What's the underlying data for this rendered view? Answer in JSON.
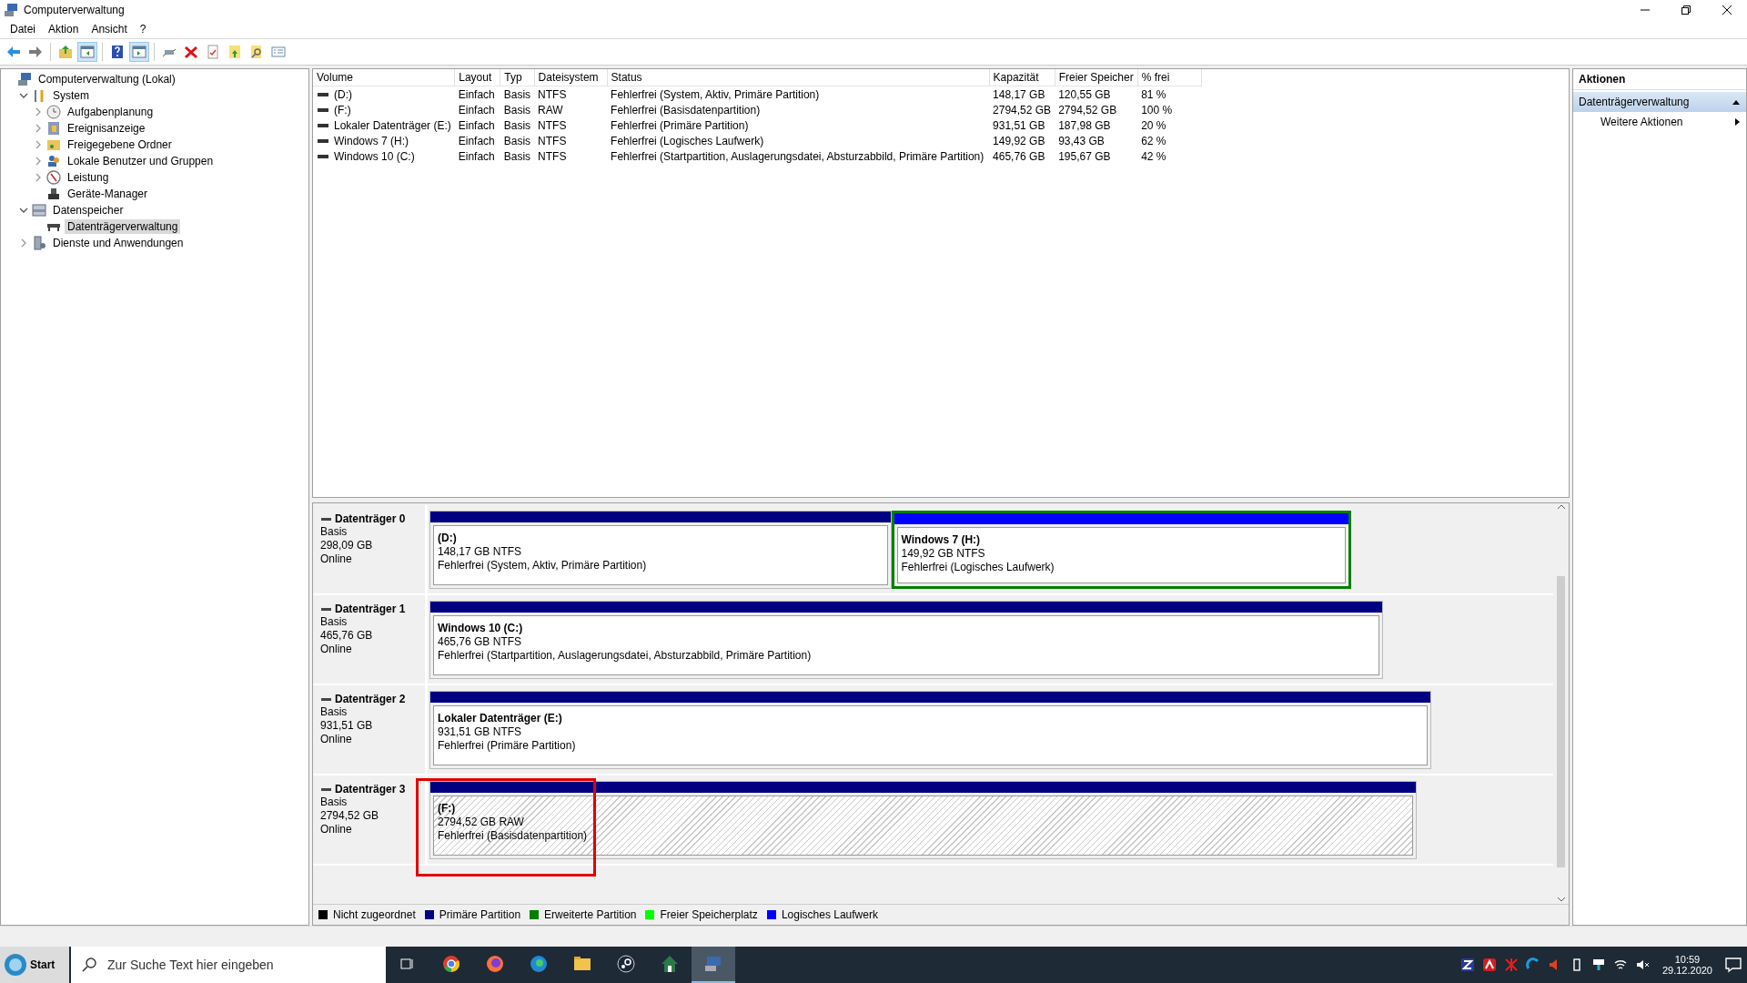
{
  "window": {
    "title": "Computerverwaltung"
  },
  "menu": [
    "Datei",
    "Aktion",
    "Ansicht",
    "?"
  ],
  "toolbar": [
    {
      "kind": "back",
      "pressed": false
    },
    {
      "kind": "forward",
      "pressed": false
    },
    {
      "kind": "sep"
    },
    {
      "kind": "up",
      "pressed": false
    },
    {
      "kind": "pane",
      "pressed": true
    },
    {
      "kind": "sep"
    },
    {
      "kind": "help",
      "pressed": false
    },
    {
      "kind": "pane2",
      "pressed": true
    },
    {
      "kind": "sep"
    },
    {
      "kind": "connect",
      "pressed": false
    },
    {
      "kind": "delete",
      "pressed": false
    },
    {
      "kind": "properties",
      "pressed": false
    },
    {
      "kind": "export",
      "pressed": false
    },
    {
      "kind": "find",
      "pressed": false
    },
    {
      "kind": "list",
      "pressed": false
    }
  ],
  "tree": [
    {
      "label": "Computerverwaltung (Lokal)",
      "selected": false,
      "children": [
        {
          "label": "System",
          "selected": false,
          "expanded": true,
          "children": [
            {
              "label": "Aufgabenplanung",
              "selected": false,
              "expanded": false
            },
            {
              "label": "Ereignisanzeige",
              "selected": false,
              "expanded": false
            },
            {
              "label": "Freigegebene Ordner",
              "selected": false,
              "expanded": false
            },
            {
              "label": "Lokale Benutzer und Gruppen",
              "selected": false,
              "expanded": false
            },
            {
              "label": "Leistung",
              "selected": false,
              "expanded": false
            },
            {
              "label": "Geräte-Manager",
              "selected": false
            }
          ]
        },
        {
          "label": "Datenspeicher",
          "selected": false,
          "expanded": true,
          "children": [
            {
              "label": "Datenträgerverwaltung",
              "selected": true
            }
          ]
        },
        {
          "label": "Dienste und Anwendungen",
          "selected": false,
          "expanded": false
        }
      ]
    }
  ],
  "volumes": {
    "columns": [
      "Volume",
      "Layout",
      "Typ",
      "Dateisystem",
      "Status",
      "Kapazität",
      "Freier Speicher",
      "% frei"
    ],
    "rows": [
      [
        "(D:)",
        "Einfach",
        "Basis",
        "NTFS",
        "Fehlerfrei (System, Aktiv, Primäre Partition)",
        "148,17 GB",
        "120,55 GB",
        "81 %"
      ],
      [
        "(F:)",
        "Einfach",
        "Basis",
        "RAW",
        "Fehlerfrei (Basisdatenpartition)",
        "2794,52 GB",
        "2794,52 GB",
        "100 %"
      ],
      [
        "Lokaler Datenträger (E:)",
        "Einfach",
        "Basis",
        "NTFS",
        "Fehlerfrei (Primäre Partition)",
        "931,51 GB",
        "187,98 GB",
        "20 %"
      ],
      [
        "Windows 7 (H:)",
        "Einfach",
        "Basis",
        "NTFS",
        "Fehlerfrei (Logisches Laufwerk)",
        "149,92 GB",
        "93,43 GB",
        "62 %"
      ],
      [
        "Windows 10 (C:)",
        "Einfach",
        "Basis",
        "NTFS",
        "Fehlerfrei (Startpartition, Auslagerungsdatei, Absturzabbild, Primäre Partition)",
        "465,76 GB",
        "195,67 GB",
        "42 %"
      ]
    ]
  },
  "disks": [
    {
      "name": "Datenträger 0",
      "type": "Basis",
      "size": "298,09 GB",
      "state": "Online",
      "partitions": [
        {
          "kind": "primary",
          "selected": false,
          "name": "(D:)",
          "size": "148,17 GB NTFS",
          "status": "Fehlerfrei (System, Aktiv, Primäre Partition)"
        },
        {
          "kind": "logical",
          "selected": false,
          "name": "Windows 7  (H:)",
          "size": "149,92 GB NTFS",
          "status": "Fehlerfrei (Logisches Laufwerk)"
        }
      ]
    },
    {
      "name": "Datenträger 1",
      "type": "Basis",
      "size": "465,76 GB",
      "state": "Online",
      "partitions": [
        {
          "kind": "primary",
          "selected": false,
          "name": "Windows 10  (C:)",
          "size": "465,76 GB NTFS",
          "status": "Fehlerfrei (Startpartition, Auslagerungsdatei, Absturzabbild, Primäre Partition)"
        }
      ]
    },
    {
      "name": "Datenträger 2",
      "type": "Basis",
      "size": "931,51 GB",
      "state": "Online",
      "partitions": [
        {
          "kind": "primary",
          "selected": false,
          "name": "Lokaler Datenträger  (E:)",
          "size": "931,51 GB NTFS",
          "status": "Fehlerfrei (Primäre Partition)"
        }
      ]
    },
    {
      "name": "Datenträger 3",
      "type": "Basis",
      "size": "2794,52 GB",
      "state": "Online",
      "highlighted": true,
      "partitions": [
        {
          "kind": "primary",
          "selected": true,
          "name": "(F:)",
          "size": "2794,52 GB RAW",
          "status": "Fehlerfrei (Basisdatenpartition)"
        }
      ]
    }
  ],
  "legend": [
    {
      "label": "Nicht zugeordnet",
      "color": "#000000"
    },
    {
      "label": "Primäre Partition",
      "color": "#000080"
    },
    {
      "label": "Erweiterte Partition",
      "color": "#008000"
    },
    {
      "label": "Freier Speicherplatz",
      "color": "#00ff00"
    },
    {
      "label": "Logisches Laufwerk",
      "color": "#0000ff"
    }
  ],
  "actions": {
    "title": "Aktionen",
    "section": "Datenträgerverwaltung",
    "items": [
      "Weitere Aktionen"
    ]
  },
  "taskbar": {
    "start": "Start",
    "search_placeholder": "Zur Suche Text hier eingeben",
    "apps": [
      {
        "kind": "taskview",
        "active": false
      },
      {
        "kind": "chrome",
        "active": false
      },
      {
        "kind": "firefox",
        "active": false
      },
      {
        "kind": "edge",
        "active": false
      },
      {
        "kind": "explorer",
        "active": false
      },
      {
        "kind": "steam",
        "active": false
      },
      {
        "kind": "home",
        "active": false
      },
      {
        "kind": "mmc",
        "active": true
      }
    ],
    "time": "10:59",
    "date": "29.12.2020"
  }
}
